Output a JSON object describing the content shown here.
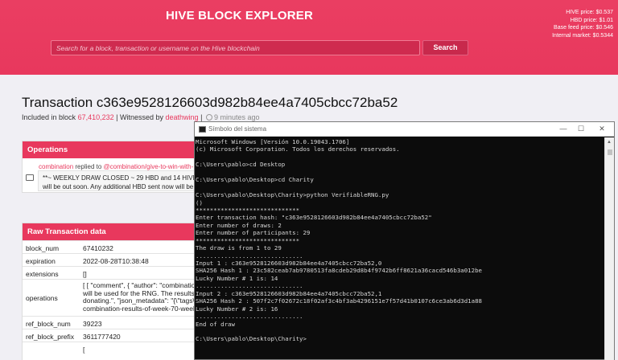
{
  "header": {
    "brand": "HIVE BLOCK EXPLORER",
    "prices": [
      "HIVE price: $0.537",
      "HBD price: $1.01",
      "Base feed price: $0.546",
      "Internal market: $0.5344"
    ],
    "search_placeholder": "Search for a block, transaction or username on the Hive blockchain",
    "search_button": "Search"
  },
  "transaction": {
    "title": "Transaction c363e9528126603d982b84ee4a7405cbcc72ba52",
    "included_prefix": "Included in block",
    "block": "67,410,232",
    "witnessed_prefix": "| Witnessed by",
    "witness": "deathwing",
    "sep": "|",
    "time": "9 minutes ago"
  },
  "operations": {
    "heading": "Operations",
    "user": "combination",
    "verb": "replied to",
    "target": "@combination/give-to-win-with-",
    "body_line1": "**~ WEEKLY DRAW CLOSED ~ 29 HBD and 14 HIVE",
    "body_line2": "will be out soon. Any additional HBD sent now will be"
  },
  "raw": {
    "heading": "Raw Transaction data",
    "rows": [
      {
        "key": "block_num",
        "value": "67410232"
      },
      {
        "key": "expiration",
        "value": "2022-08-28T10:38:48"
      },
      {
        "key": "extensions",
        "value": "[]"
      },
      {
        "key": "operations",
        "value": "[ [ \"comment\", { \"author\": \"combination\" will be used for the RNG. The results w donating.\", \"json_metadata\": \"{\\\"tags\\\":[ combination-results-of-week-70-week-7"
      },
      {
        "key": "ref_block_num",
        "value": "39223"
      },
      {
        "key": "ref_block_prefix",
        "value": "3611777420"
      },
      {
        "key": "",
        "value": "["
      }
    ]
  },
  "console": {
    "title": "Símbolo del sistema",
    "min": "—",
    "max": "☐",
    "close": "✕",
    "lines": [
      "Microsoft Windows [Versión 10.0.19043.1706]",
      "(c) Microsoft Corporation. Todos los derechos reservados.",
      "",
      "C:\\Users\\pablo>cd Desktop",
      "",
      "C:\\Users\\pablo\\Desktop>cd Charity",
      "",
      "C:\\Users\\pablo\\Desktop\\Charity>python VerifiableRNG.py",
      "()",
      "*****************************",
      "Enter transaction hash: \"c363e9528126603d982b84ee4a7405cbcc72ba52\"",
      "Enter number of draws: 2",
      "Enter number of participants: 29",
      "*****************************",
      "The draw is from 1 to 29",
      "..............................",
      "Input 1 : c363e9528126603d982b84ee4a7405cbcc72ba52,0",
      "SHA256 Hash 1 : 23c582ceab7ab9780513fa8cdeb29d8b4f9742b6ff8621a36cacd546b3a012be",
      "Lucky Number # 1 is: 14",
      "..............................",
      "Input 2 : c363e9528126603d982b84ee4a7405cbcc72ba52,1",
      "SHA256 Hash 2 : 507f2c7f02672c18f02af3c4bf3ab4296151e7f57d41b0107c6ce3ab6d3d1a88",
      "Lucky Number # 2 is: 16",
      "..............................",
      "End of draw",
      "",
      "C:\\Users\\pablo\\Desktop\\Charity>"
    ]
  }
}
